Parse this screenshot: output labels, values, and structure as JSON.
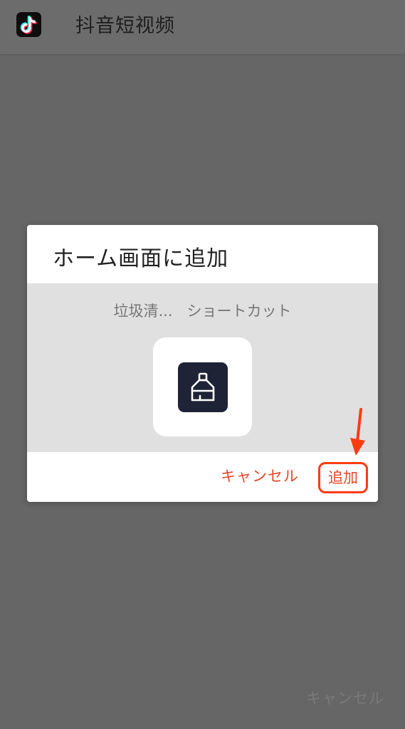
{
  "app_bar": {
    "title": "抖音短视频",
    "icon": "tiktok-logo"
  },
  "dialog": {
    "title": "ホーム画面に追加",
    "shortcut_app_name": "垃圾清...",
    "shortcut_type": "ショートカット",
    "shortcut_icon": "broom-icon",
    "cancel_label": "キャンセル",
    "add_label": "追加"
  },
  "annotation": {
    "arrow_icon": "red-arrow-down",
    "highlight_color": "#ff3b12"
  },
  "background": {
    "cancel_label": "キャンセル"
  },
  "colors": {
    "accent": "#e4472a",
    "overlay": "#666666",
    "icon_tile": "#1e2336"
  }
}
